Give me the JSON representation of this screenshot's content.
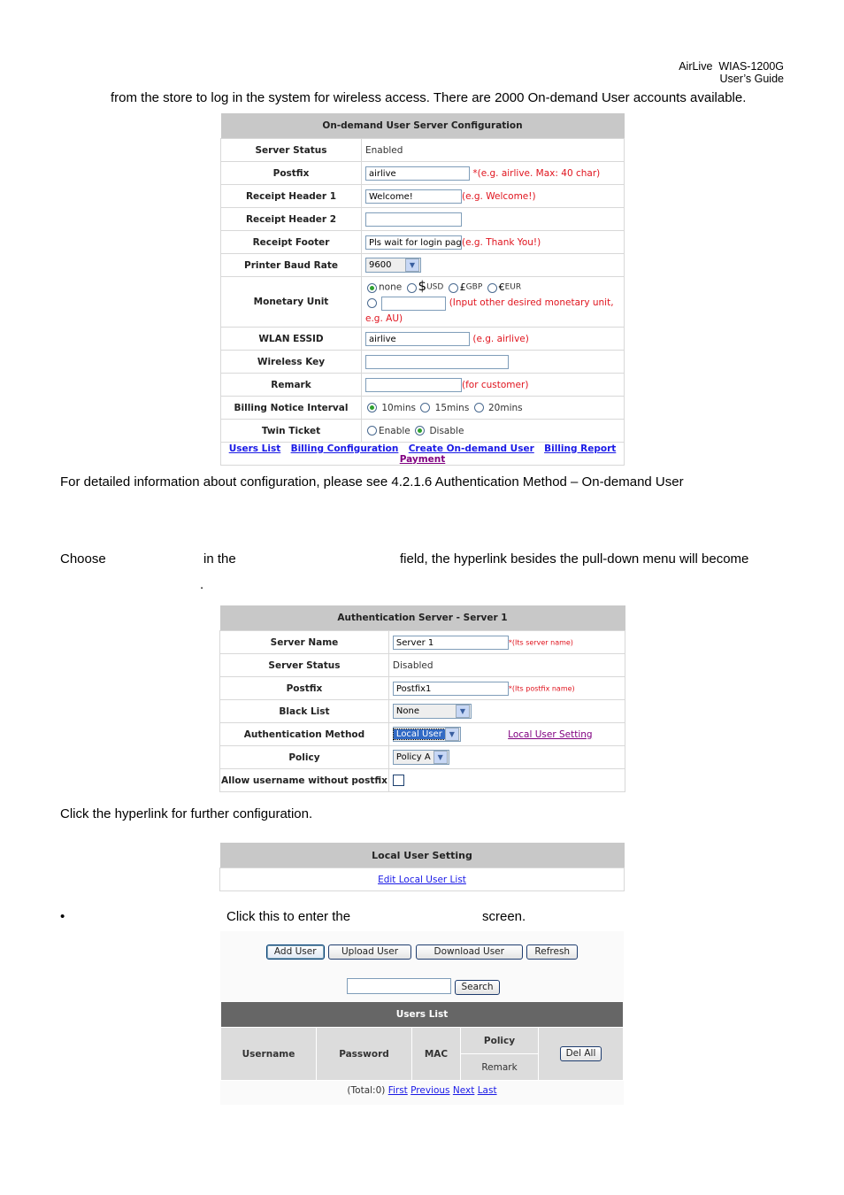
{
  "header": {
    "product": "AirLive  WIAS-1200G",
    "guide": "User’s  Guide"
  },
  "intro_text": "from the store to log in the system for wireless access. There are 2000 On-demand User accounts available.",
  "ondemand": {
    "title": "On-demand User Server Configuration",
    "server_status_label": "Server Status",
    "server_status_value": "Enabled",
    "postfix_label": "Postfix",
    "postfix_value": "airlive",
    "postfix_hint": "*(e.g. airlive. Max: 40 char)",
    "rh1_label": "Receipt Header 1",
    "rh1_value": "Welcome!",
    "rh1_hint": "(e.g. Welcome!)",
    "rh2_label": "Receipt Header 2",
    "rh2_value": "",
    "footer_label": "Receipt Footer",
    "footer_value": "Pls wait for login page",
    "footer_hint": "(e.g. Thank You!)",
    "baud_label": "Printer Baud Rate",
    "baud_value": "9600",
    "monetary_label": "Monetary Unit",
    "monetary_options": {
      "none": "none",
      "usd_symbol": "$",
      "usd": "USD",
      "gbp_symbol": "£",
      "gbp": "GBP",
      "eur_symbol": "€",
      "eur": "EUR"
    },
    "monetary_selected": "none",
    "monetary_other_hint": "(Input other desired monetary unit, e.g. AU)",
    "essid_label": "WLAN ESSID",
    "essid_value": "airlive",
    "essid_hint": "(e.g. airlive)",
    "wkey_label": "Wireless Key",
    "wkey_value": "",
    "remark_label": "Remark",
    "remark_value": "",
    "remark_hint": "(for customer)",
    "billing_label": "Billing Notice Interval",
    "billing_options": [
      "10mins",
      "15mins",
      "20mins"
    ],
    "billing_selected": "10mins",
    "twin_label": "Twin Ticket",
    "twin_options": [
      "Enable",
      "Disable"
    ],
    "twin_selected": "Disable",
    "links": [
      "Users List",
      "Billing Configuration",
      "Create On-demand User",
      "Billing Report",
      "Payment"
    ]
  },
  "detail_text": "For detailed information about configuration, please see 4.2.1.6 Authentication Method – On-demand User",
  "choose_text": {
    "part1": "Choose",
    "part2": "in the",
    "part3": "field, the hyperlink besides the pull-down menu will become",
    "part4": "."
  },
  "authserver": {
    "title": "Authentication Server - Server 1",
    "name_label": "Server Name",
    "name_value": "Server 1",
    "name_hint": "*(Its server name)",
    "status_label": "Server Status",
    "status_value": "Disabled",
    "postfix_label": "Postfix",
    "postfix_value": "Postfix1",
    "postfix_hint": "*(Its postfix name)",
    "blacklist_label": "Black List",
    "blacklist_value": "None",
    "method_label": "Authentication Method",
    "method_value": "Local User",
    "method_link": "Local User Setting",
    "policy_label": "Policy",
    "policy_value": "Policy A",
    "allow_label": "Allow username without postfix",
    "allow_checked": false
  },
  "click_text": "Click the hyperlink for further configuration.",
  "localuser": {
    "title": "Local User Setting",
    "link": "Edit Local User List"
  },
  "bullet": {
    "symbol": "•",
    "text1": "Click this to enter the",
    "text2": "screen."
  },
  "userslist": {
    "buttons": {
      "add": "Add User",
      "upload": "Upload User",
      "download": "Download User",
      "refresh": "Refresh"
    },
    "search_value": "",
    "search_button": "Search",
    "title": "Users List",
    "columns": {
      "username": "Username",
      "password": "Password",
      "mac": "MAC",
      "policy": "Policy",
      "remark": "Remark"
    },
    "delall": "Del All",
    "pager": {
      "total": "(Total:0)",
      "first": "First",
      "previous": "Previous",
      "next": "Next",
      "last": "Last"
    }
  }
}
